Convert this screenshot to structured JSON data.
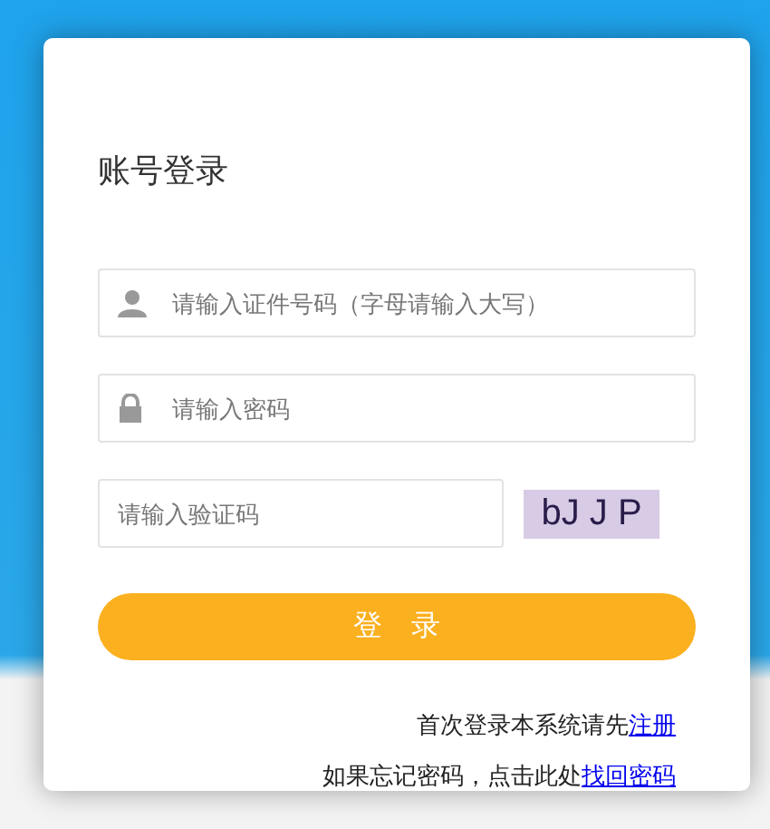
{
  "title": "账号登录",
  "fields": [
    {
      "kind": "user",
      "placeholder": "请输入证件号码（字母请输入大写）"
    },
    {
      "kind": "lock",
      "placeholder": "请输入密码"
    }
  ],
  "captcha": {
    "placeholder": "请输入验证码",
    "code": "bJ J P"
  },
  "login_button": "登　录",
  "links": [
    {
      "text": "首次登录本系统请先",
      "link": "注册"
    },
    {
      "text": "如果忘记密码，点击此处",
      "link": "找回密码"
    }
  ]
}
